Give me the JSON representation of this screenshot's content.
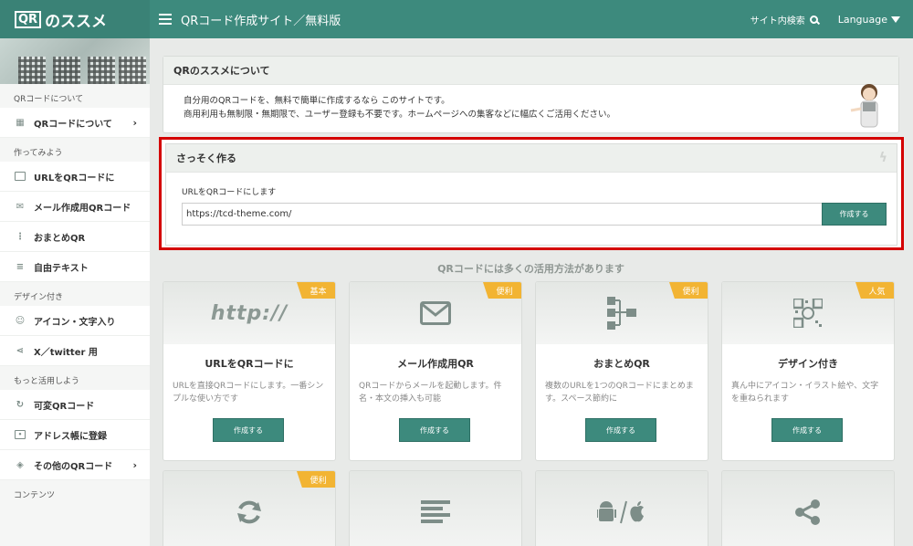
{
  "header": {
    "logo_qr": "QR",
    "logo_text": "のススメ",
    "title": "QRコード作成サイト／無料版",
    "search_label": "サイト内検索",
    "language_label": "Language"
  },
  "sidebar": {
    "sections": [
      {
        "label": "QRコードについて",
        "items": [
          {
            "label": "QRコードについて",
            "icon": "qr-grid-icon",
            "chevron": "›"
          }
        ]
      },
      {
        "label": "作ってみよう",
        "items": [
          {
            "label": "URLをQRコードに",
            "icon": "browser-icon"
          },
          {
            "label": "メール作成用QRコード",
            "icon": "envelope-icon"
          },
          {
            "label": "おまとめQR",
            "icon": "sitemap-icon"
          },
          {
            "label": "自由テキスト",
            "icon": "text-lines-icon"
          }
        ]
      },
      {
        "label": "デザイン付き",
        "items": [
          {
            "label": "アイコン・文字入り",
            "icon": "smile-icon"
          },
          {
            "label": "X／twitter 用",
            "icon": "share-icon"
          }
        ]
      },
      {
        "label": "もっと活用しよう",
        "items": [
          {
            "label": "可変QRコード",
            "icon": "refresh-icon"
          },
          {
            "label": "アドレス帳に登録",
            "icon": "contact-card-icon"
          },
          {
            "label": "その他のQRコード",
            "icon": "cube-icon",
            "chevron": "›"
          }
        ]
      },
      {
        "label": "コンテンツ",
        "items": []
      }
    ]
  },
  "about": {
    "title": "QRのススメについて",
    "line1": "自分用のQRコードを、無料で簡単に作成するなら このサイトです。",
    "line2": "商用利用も無制限・無期限で、ユーザー登録も不要です。ホームページへの集客などに幅広くご活用ください。"
  },
  "quick": {
    "title": "さっそく作る",
    "label": "URLをQRコードにします",
    "input_value": "https://tcd-theme.com/",
    "button": "作成する"
  },
  "features_heading": "QRコードには多くの活用方法があります",
  "features": [
    {
      "badge": "基本",
      "icon": "http-icon",
      "icon_text": "http://",
      "title": "URLをQRコードに",
      "desc": "URLを直接QRコードにします。一番シンプルな使い方です",
      "button": "作成する"
    },
    {
      "badge": "便利",
      "icon": "envelope-icon",
      "title": "メール作成用QR",
      "desc": "QRコードからメールを起動します。件名・本文の挿入も可能",
      "button": "作成する"
    },
    {
      "badge": "便利",
      "icon": "sitemap-icon",
      "title": "おまとめQR",
      "desc": "複数のURLを1つのQRコードにまとめます。スペース節約に",
      "button": "作成する"
    },
    {
      "badge": "人気",
      "icon": "qr-smile-icon",
      "title": "デザイン付き",
      "desc": "真ん中にアイコン・イラスト絵や、文字を重ねられます",
      "button": "作成する"
    },
    {
      "badge": "便利",
      "icon": "refresh-icon"
    },
    {
      "icon": "text-lines-icon"
    },
    {
      "icon": "android-apple-icon"
    },
    {
      "icon": "share-icon"
    }
  ],
  "colors": {
    "accent": "#3d8a7d",
    "badge": "#f2b433",
    "highlight": "#d40000"
  }
}
